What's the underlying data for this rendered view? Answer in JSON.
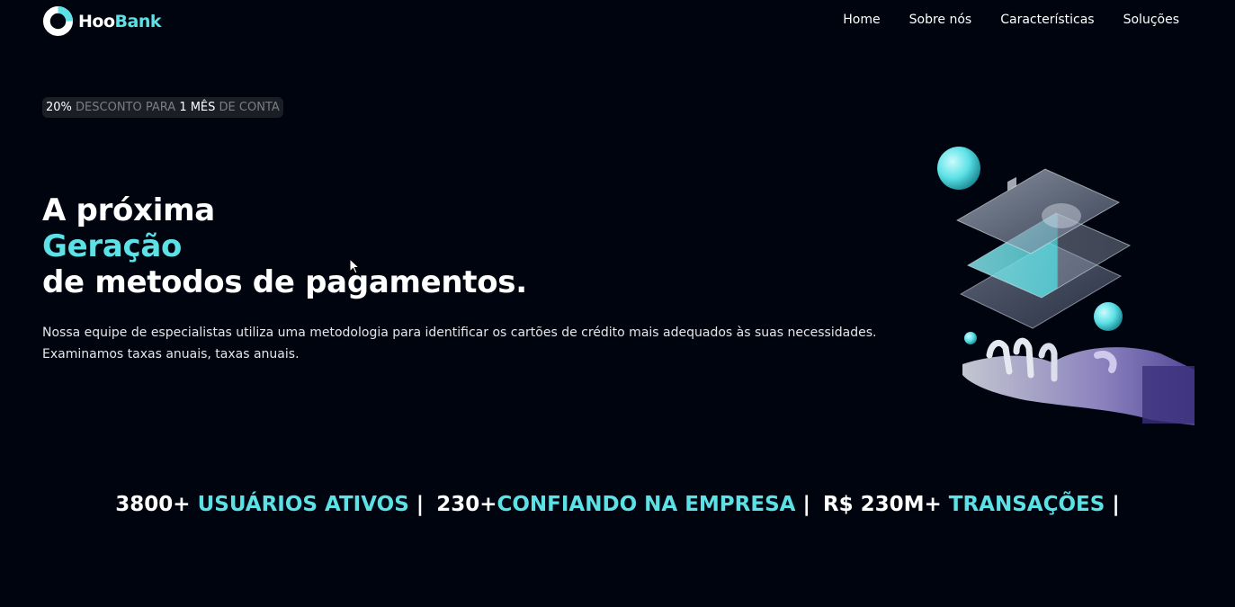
{
  "brand": {
    "name_part1": "Hoo",
    "name_part2": "Bank",
    "accent_color": "#5ce1e6",
    "background_color": "#00040f",
    "logo_icon": "hoobank-logo-icon"
  },
  "nav": {
    "items": [
      {
        "label": "Home"
      },
      {
        "label": "Sobre nós"
      },
      {
        "label": "Características"
      },
      {
        "label": "Soluções"
      }
    ]
  },
  "badge": {
    "percent": "20%",
    "text1": "DESCONTO PARA",
    "period": "1 MÊS",
    "text2": "DE CONTA"
  },
  "hero": {
    "line1": "A próxima",
    "line2": "Geração",
    "line3": "de metodos de pagamentos.",
    "description": "Nossa equipe de especialistas utiliza uma metodologia para identificar os cartões de crédito mais adequados às suas necessidades. Examinamos taxas anuais, taxas anuais.",
    "illustration": "robot-hand-cards-illustration"
  },
  "stats": [
    {
      "value": "3800+",
      "label": "USUÁRIOS ATIVOS",
      "separator": "|"
    },
    {
      "value": "230+",
      "label": "CONFIANDO NA EMPRESA",
      "separator": "|"
    },
    {
      "value": "R$ 230M+",
      "label": "TRANSAÇÕES",
      "separator": "|"
    }
  ]
}
